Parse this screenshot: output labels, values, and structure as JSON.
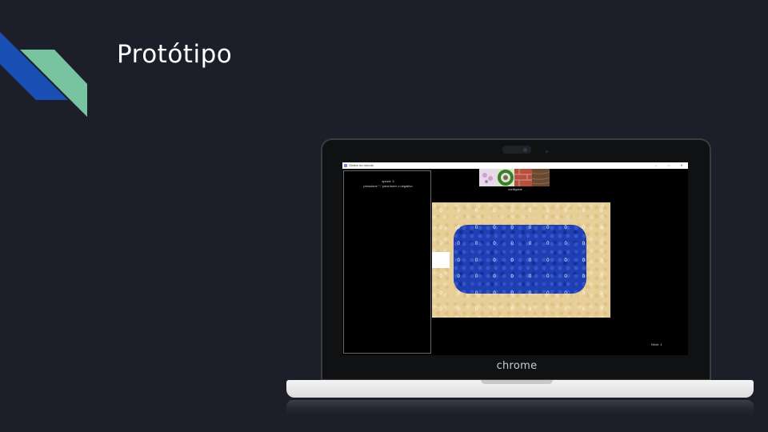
{
  "slide": {
    "title": "Protótipo"
  },
  "laptop": {
    "brand": "chrome"
  },
  "app": {
    "window_title": "Gestor do mundo",
    "window_buttons": {
      "minimize": "–",
      "maximize": "□",
      "close": "✕"
    },
    "side_panel": {
      "line1": "speed: 3",
      "line2": "pressione \"-\" para fazer o negativo"
    },
    "tiles_label": "configurar",
    "tiles": [
      {
        "name": "flowers-tile",
        "color": "#c9a6c9"
      },
      {
        "name": "wreath-tile",
        "color": "#3b7d2a"
      },
      {
        "name": "brick-tile",
        "color": "#b5513e"
      },
      {
        "name": "wood-tile",
        "color": "#6b4a33"
      }
    ],
    "grid": {
      "cols": 10,
      "rows": 7,
      "cell_value": "0"
    },
    "status": "Nível: 1",
    "colors": {
      "sand": "#e7cf97",
      "water": "#1f3fb4",
      "background": "#000000"
    }
  }
}
